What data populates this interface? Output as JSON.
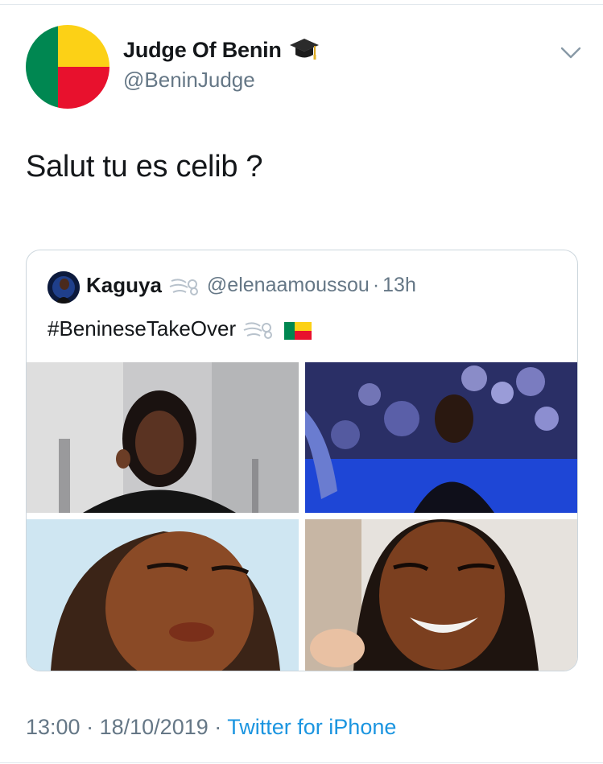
{
  "tweet": {
    "author_name": "Judge Of Benin",
    "author_handle": "@BeninJudge",
    "name_emoji": "graduation-cap-icon",
    "text": "Salut tu es celib ?",
    "timestamp_time": "13:00",
    "separator": "·",
    "timestamp_date": "18/10/2019",
    "source": "Twitter for iPhone",
    "colors": {
      "text": "#14171a",
      "muted": "#657786",
      "link": "#1b95e0",
      "border": "#ccd6dd"
    }
  },
  "quoted_tweet": {
    "author_name": "Kaguya",
    "author_handle": "@elenaamoussou",
    "separator": "·",
    "age": "13h",
    "text": "#BenineseTakeOver",
    "emojis": [
      "dash-icon",
      "benin-flag-icon"
    ]
  },
  "flag_colors": {
    "green": "#008751",
    "yellow": "#fcd116",
    "red": "#e8112d"
  }
}
